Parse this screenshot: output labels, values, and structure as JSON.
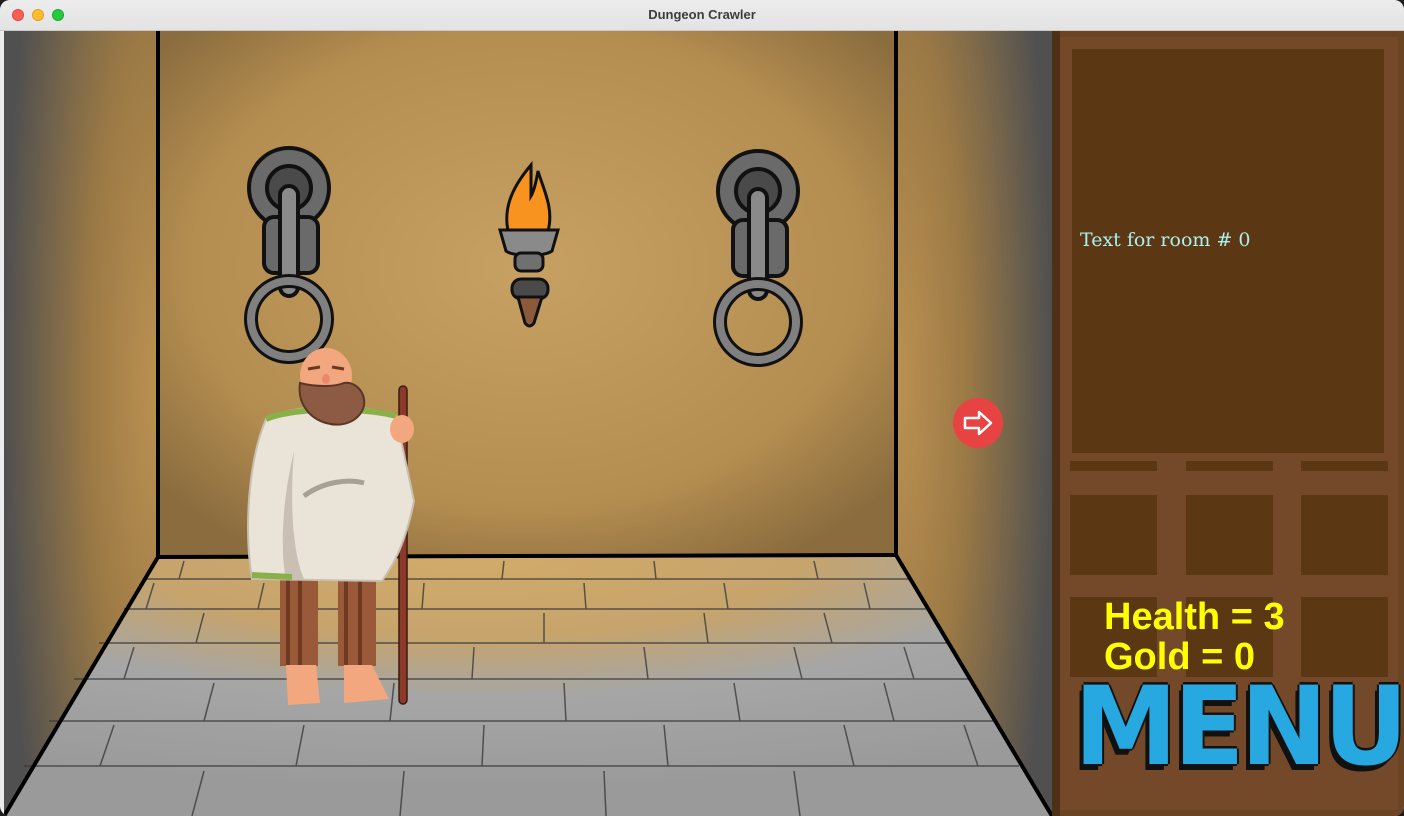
{
  "window": {
    "title": "Dungeon Crawler"
  },
  "game": {
    "room_text": "Text for room # 0",
    "health_label": "Health = 3",
    "gold_label": "Gold = 0",
    "health": 3,
    "gold": 0,
    "room_number": 0,
    "menu_label": "MENU",
    "next_arrow_icon": "arrow-right-icon"
  },
  "colors": {
    "wall": "#b89152",
    "floor": "#a6a6a6",
    "side_dark": "#505050",
    "panel_wood": "#6b4523",
    "panel_dark": "#5c3714",
    "stats_text": "#ffff00",
    "room_text": "#aaf0f0",
    "menu_blue": "#27a8e0",
    "arrow_button": "#e84343"
  }
}
